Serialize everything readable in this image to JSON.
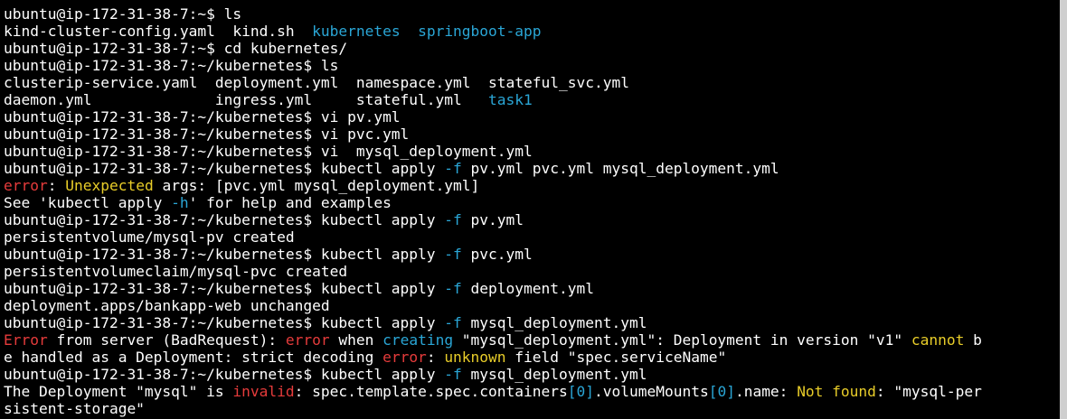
{
  "colors": {
    "background": "#000000",
    "foreground": "#ffffff",
    "red": "#e53b3b",
    "yellow": "#e8cd29",
    "cyan": "#2aa6d6",
    "scrollbar": "#cfcfcf"
  },
  "lines": [
    [
      {
        "t": "ubuntu@ip-172-31-38-7:~$ ls",
        "c": "default"
      }
    ],
    [
      {
        "t": "kind-cluster-config.yaml  kind.sh  ",
        "c": "default"
      },
      {
        "t": "kubernetes",
        "c": "cyan"
      },
      {
        "t": "  ",
        "c": "default"
      },
      {
        "t": "springboot-app",
        "c": "cyan"
      }
    ],
    [
      {
        "t": "ubuntu@ip-172-31-38-7:~$ cd kubernetes/",
        "c": "default"
      }
    ],
    [
      {
        "t": "ubuntu@ip-172-31-38-7:~/kubernetes$ ls",
        "c": "default"
      }
    ],
    [
      {
        "t": "clusterip-service.yaml  deployment.yml  namespace.yml  stateful_svc.yml",
        "c": "default"
      }
    ],
    [
      {
        "t": "daemon.yml              ingress.yml     stateful.yml   ",
        "c": "default"
      },
      {
        "t": "task1",
        "c": "cyan"
      }
    ],
    [
      {
        "t": "ubuntu@ip-172-31-38-7:~/kubernetes$ vi pv.yml",
        "c": "default"
      }
    ],
    [
      {
        "t": "ubuntu@ip-172-31-38-7:~/kubernetes$ vi pvc.yml",
        "c": "default"
      }
    ],
    [
      {
        "t": "ubuntu@ip-172-31-38-7:~/kubernetes$ vi  mysql_deployment.yml",
        "c": "default"
      }
    ],
    [
      {
        "t": "ubuntu@ip-172-31-38-7:~/kubernetes$ kubectl apply ",
        "c": "default"
      },
      {
        "t": "-f",
        "c": "cyan"
      },
      {
        "t": " pv.yml pvc.yml mysql_deployment.yml",
        "c": "default"
      }
    ],
    [
      {
        "t": "error",
        "c": "red"
      },
      {
        "t": ": ",
        "c": "default"
      },
      {
        "t": "Unexpected",
        "c": "yellow"
      },
      {
        "t": " args: [pvc.yml mysql_deployment.yml]",
        "c": "default"
      }
    ],
    [
      {
        "t": "See 'kubectl apply ",
        "c": "default"
      },
      {
        "t": "-h",
        "c": "cyan"
      },
      {
        "t": "' for help and examples",
        "c": "default"
      }
    ],
    [
      {
        "t": "ubuntu@ip-172-31-38-7:~/kubernetes$ kubectl apply ",
        "c": "default"
      },
      {
        "t": "-f",
        "c": "cyan"
      },
      {
        "t": " pv.yml",
        "c": "default"
      }
    ],
    [
      {
        "t": "persistentvolume/mysql-pv created",
        "c": "default"
      }
    ],
    [
      {
        "t": "ubuntu@ip-172-31-38-7:~/kubernetes$ kubectl apply ",
        "c": "default"
      },
      {
        "t": "-f",
        "c": "cyan"
      },
      {
        "t": " pvc.yml",
        "c": "default"
      }
    ],
    [
      {
        "t": "persistentvolumeclaim/mysql-pvc created",
        "c": "default"
      }
    ],
    [
      {
        "t": "ubuntu@ip-172-31-38-7:~/kubernetes$ kubectl apply ",
        "c": "default"
      },
      {
        "t": "-f",
        "c": "cyan"
      },
      {
        "t": " deployment.yml",
        "c": "default"
      }
    ],
    [
      {
        "t": "deployment.apps/bankapp-web unchanged",
        "c": "default"
      }
    ],
    [
      {
        "t": "ubuntu@ip-172-31-38-7:~/kubernetes$ kubectl apply ",
        "c": "default"
      },
      {
        "t": "-f",
        "c": "cyan"
      },
      {
        "t": " mysql_deployment.yml",
        "c": "default"
      }
    ],
    [
      {
        "t": "Error",
        "c": "red"
      },
      {
        "t": " from server (BadRequest): ",
        "c": "default"
      },
      {
        "t": "error",
        "c": "red"
      },
      {
        "t": " when ",
        "c": "default"
      },
      {
        "t": "creating",
        "c": "cyan"
      },
      {
        "t": " \"mysql_deployment.yml\": Deployment in version \"v1\" ",
        "c": "default"
      },
      {
        "t": "cannot",
        "c": "yellow"
      },
      {
        "t": " b",
        "c": "default"
      }
    ],
    [
      {
        "t": "e handled as a Deployment: strict decoding ",
        "c": "default"
      },
      {
        "t": "error",
        "c": "red"
      },
      {
        "t": ": ",
        "c": "default"
      },
      {
        "t": "unknown",
        "c": "yellow"
      },
      {
        "t": " field \"spec.serviceName\"",
        "c": "default"
      }
    ],
    [
      {
        "t": "ubuntu@ip-172-31-38-7:~/kubernetes$ kubectl apply ",
        "c": "default"
      },
      {
        "t": "-f",
        "c": "cyan"
      },
      {
        "t": " mysql_deployment.yml",
        "c": "default"
      }
    ],
    [
      {
        "t": "The Deployment \"mysql\" is ",
        "c": "default"
      },
      {
        "t": "invalid",
        "c": "red"
      },
      {
        "t": ": spec.template.spec.containers",
        "c": "default"
      },
      {
        "t": "[0]",
        "c": "cyan"
      },
      {
        "t": ".volumeMounts",
        "c": "default"
      },
      {
        "t": "[0]",
        "c": "cyan"
      },
      {
        "t": ".name: ",
        "c": "default"
      },
      {
        "t": "Not found",
        "c": "yellow"
      },
      {
        "t": ": \"mysql-per",
        "c": "default"
      }
    ],
    [
      {
        "t": "sistent-storage\"",
        "c": "default"
      }
    ]
  ]
}
